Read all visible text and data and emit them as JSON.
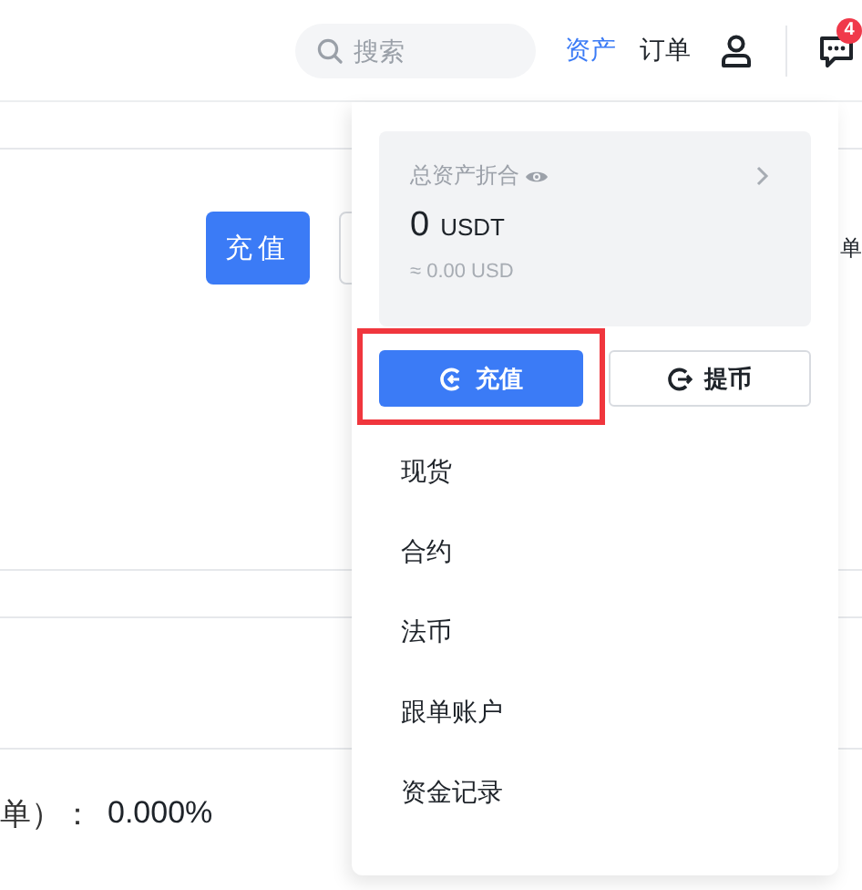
{
  "header": {
    "search": {
      "placeholder": "搜索"
    },
    "nav": [
      {
        "label": "资产",
        "selected": true
      },
      {
        "label": "订单",
        "selected": false
      }
    ],
    "notifications": {
      "count": "4"
    }
  },
  "page": {
    "buttons": [
      {
        "label": "充值",
        "kind": "primary"
      },
      {
        "kind": "outline"
      }
    ],
    "side_text": "单",
    "rate": {
      "label": "单）：",
      "value": "0.000%"
    }
  },
  "dropdown": {
    "summary": {
      "title": "总资产折合",
      "amount": "0",
      "unit": "USDT",
      "approx": "≈ 0.00 USD"
    },
    "actions": [
      {
        "label": "充值",
        "kind": "primary",
        "highlighted": true
      },
      {
        "label": "提币",
        "kind": "outline",
        "highlighted": false
      }
    ],
    "items": [
      "现货",
      "合约",
      "法币",
      "跟单账户",
      "资金记录"
    ]
  }
}
